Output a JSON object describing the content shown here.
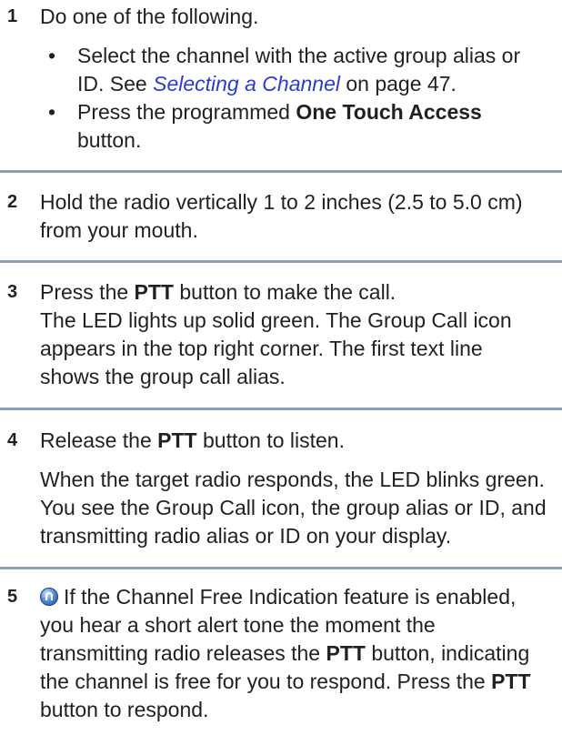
{
  "steps": [
    {
      "number": "1",
      "intro": "Do one of the following.",
      "bullets": [
        {
          "dot": "•",
          "text_a": "Select the channel with the active group alias or ID. See ",
          "link": "Selecting a Channel",
          "text_b": " on page 47."
        },
        {
          "dot": "•",
          "text_a": "Press the programmed ",
          "bold": "One Touch Access",
          "text_b": " button."
        }
      ]
    },
    {
      "number": "2",
      "text": "Hold the radio vertically 1 to 2 inches (2.5 to 5.0 cm) from your mouth."
    },
    {
      "number": "3",
      "text_a": "Press the ",
      "bold": "PTT",
      "text_b": " button to make the call.",
      "text_c": "The LED lights up solid green. The Group Call icon appears in the top right corner. The first text line shows the group call alias."
    },
    {
      "number": "4",
      "text_a": "Release the ",
      "bold": "PTT",
      "text_b": " button to listen.",
      "text_c": "When the target radio responds, the LED blinks green. You see the Group Call icon, the group alias or ID, and transmitting radio alias or ID on your display."
    },
    {
      "number": "5",
      "icon": "channel-feature-icon",
      "text_a": "If the Channel Free Indication feature is enabled, you hear a short alert tone the moment the transmitting radio releases the ",
      "bold_a": "PTT",
      "text_b": " button, indicating the channel is free for you to respond. Press the ",
      "bold_b": "PTT",
      "text_c": " button to respond."
    }
  ]
}
